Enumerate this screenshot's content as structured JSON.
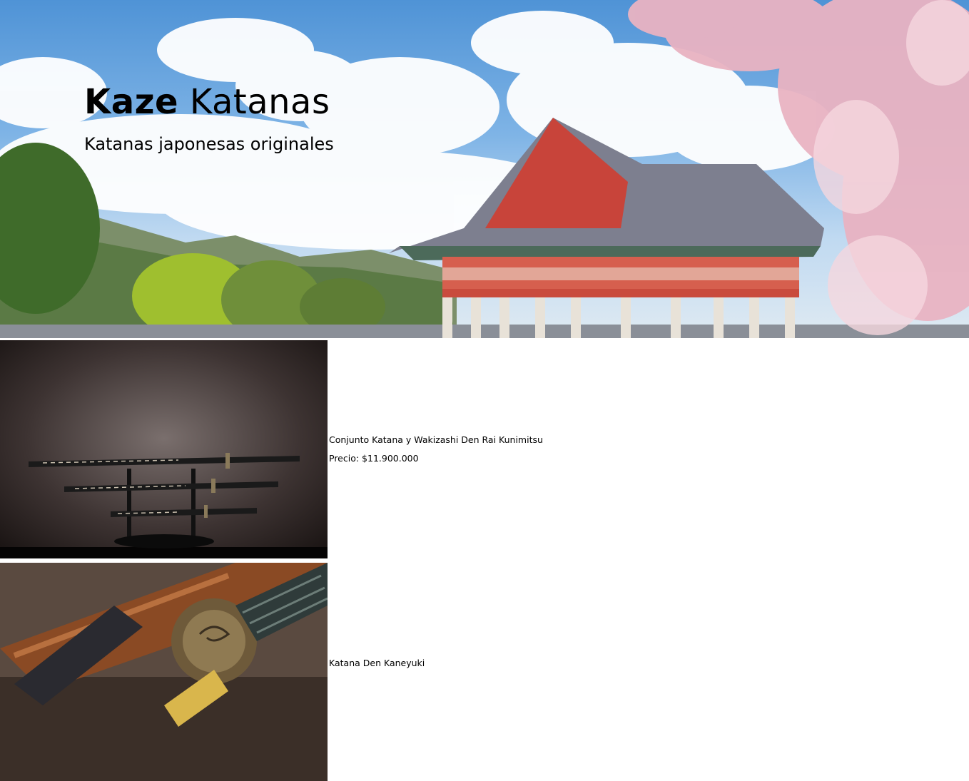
{
  "hero": {
    "title_bold": "Kaze",
    "title_rest": " Katanas",
    "subtitle": "Katanas japonesas originales"
  },
  "products": [
    {
      "name": "Conjunto Katana y Wakizashi Den Rai Kunimitsu",
      "price": "Precio: $11.900.000"
    },
    {
      "name": "Katana Den Kaneyuki",
      "price": ""
    }
  ]
}
